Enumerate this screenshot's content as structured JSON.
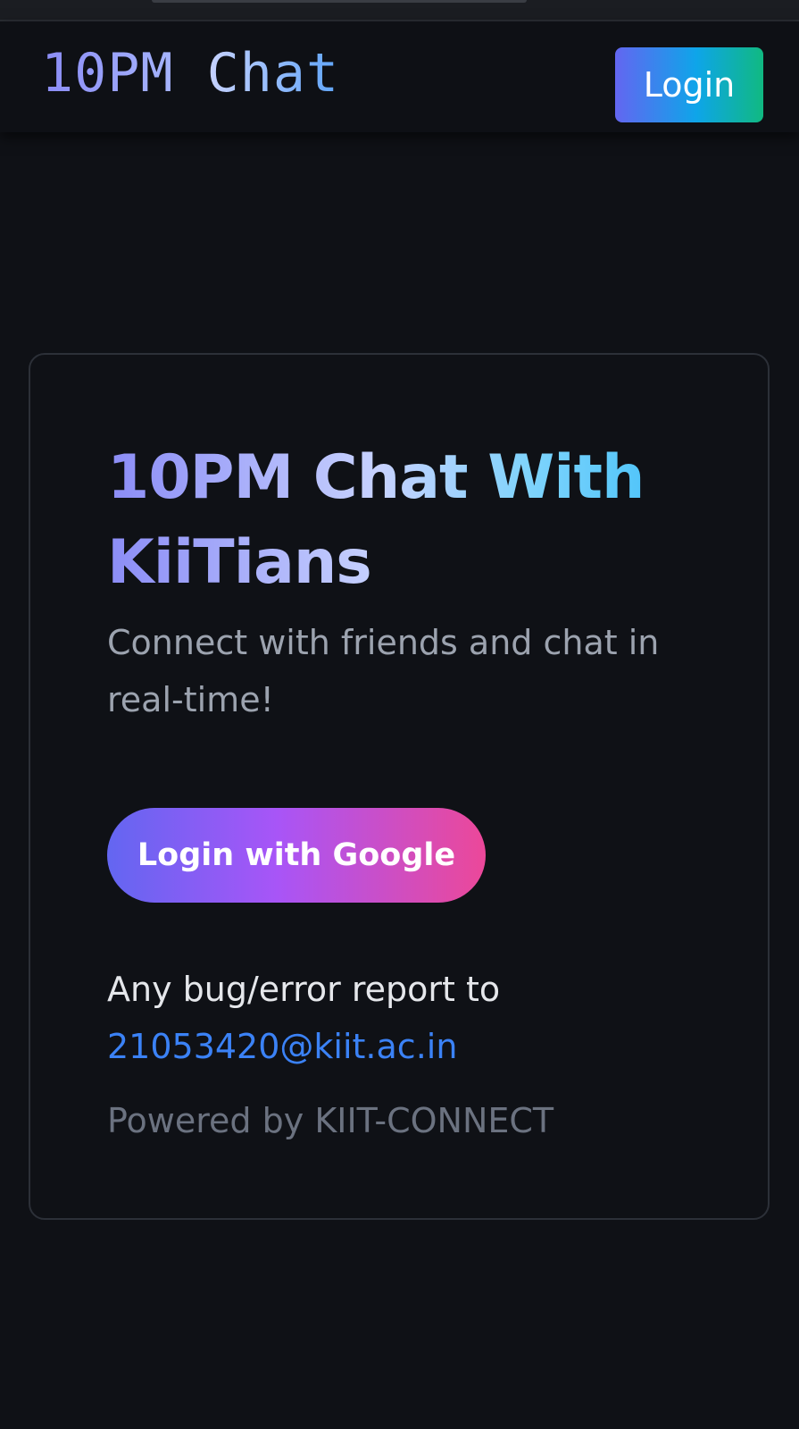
{
  "header": {
    "brand_part1": "10PM",
    "brand_part2": "Chat",
    "login_label": "Login"
  },
  "hero": {
    "title": "10PM Chat With KiiTians",
    "subtitle": "Connect with friends and chat in real-time!",
    "google_login_label": "Login with Google",
    "report_text": "Any bug/error report to",
    "report_email": "21053420@kiit.ac.in",
    "powered_by": "Powered by KIIT-CONNECT"
  },
  "colors": {
    "background": "#0f1116",
    "nav_button_gradient": [
      "#6366f1",
      "#0ea5e9",
      "#10b981"
    ],
    "google_button_gradient": [
      "#6366f1",
      "#a855f7",
      "#ec4899"
    ],
    "link": "#3b82f6"
  }
}
